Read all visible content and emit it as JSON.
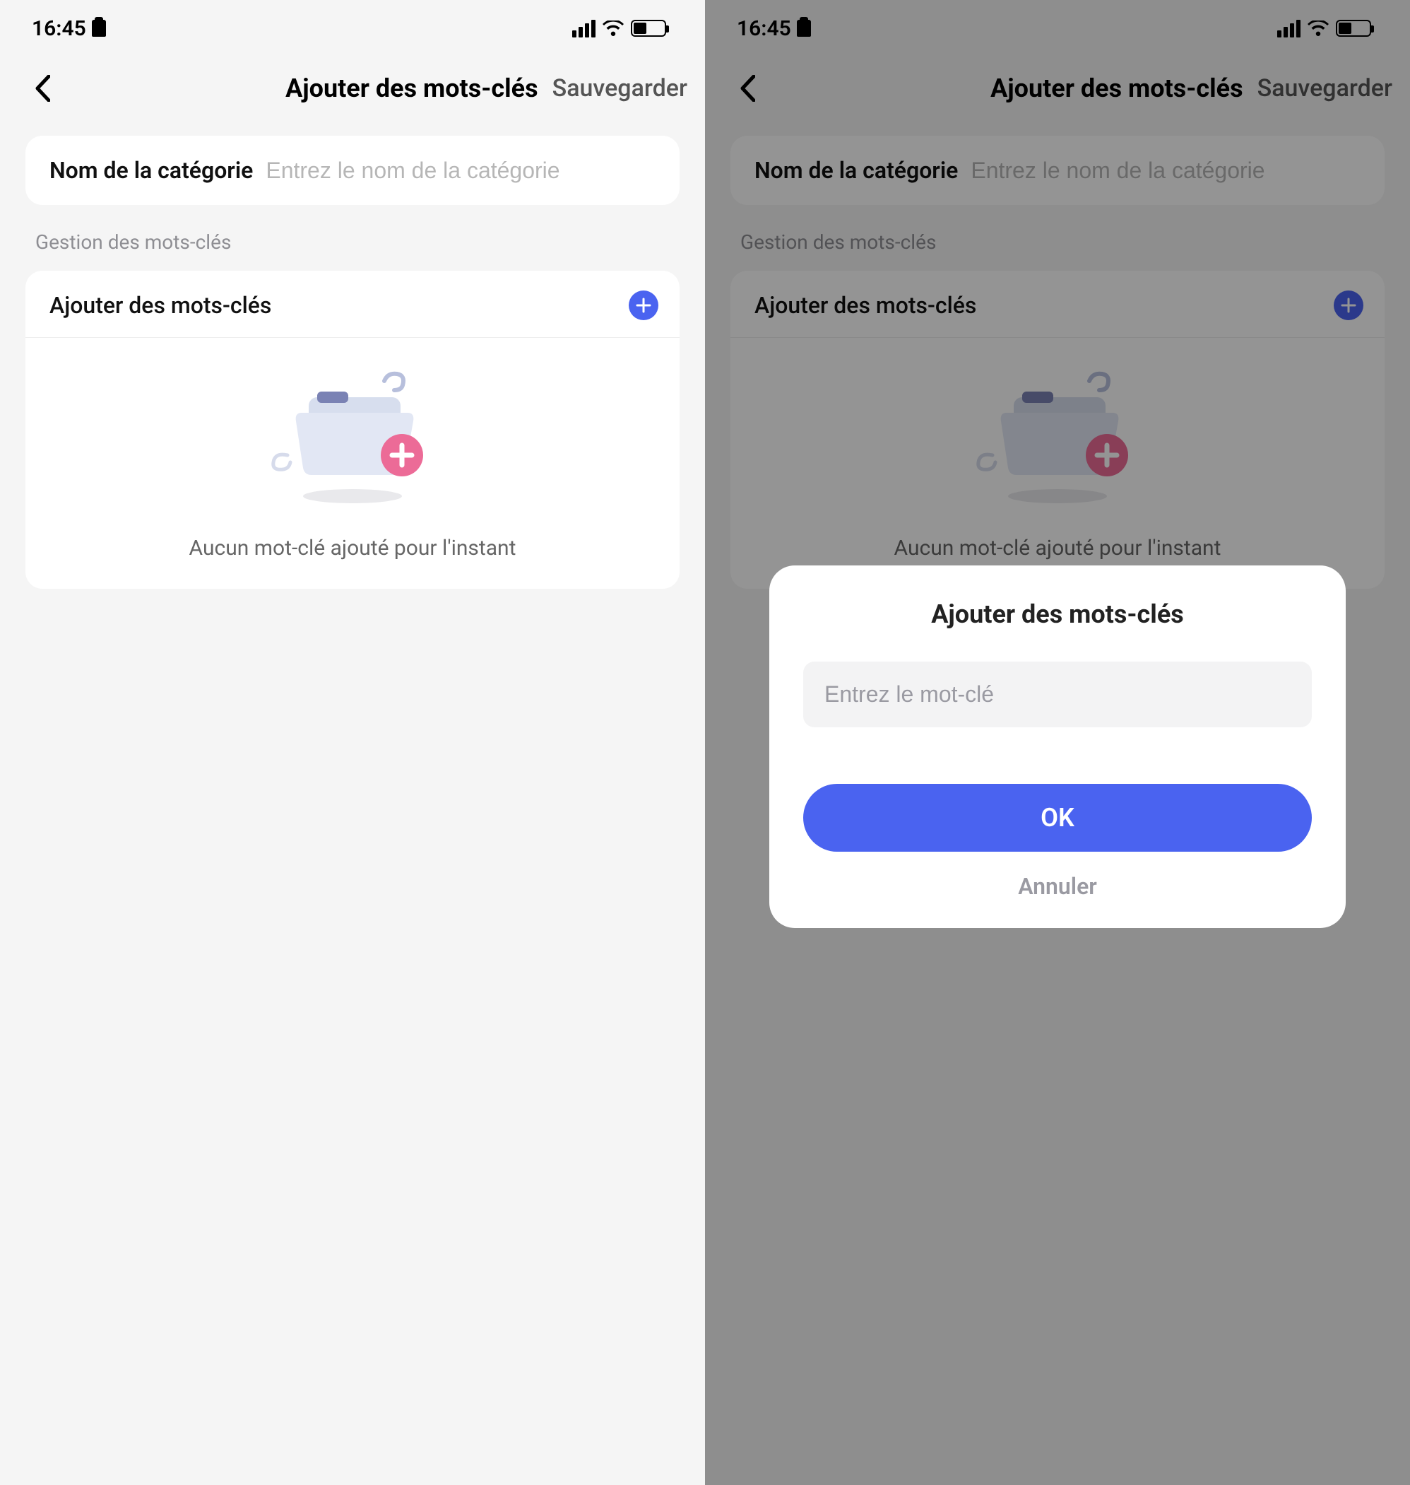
{
  "status": {
    "time": "16:45"
  },
  "nav": {
    "title": "Ajouter des mots-clés",
    "save": "Sauvegarder"
  },
  "category": {
    "label": "Nom de la catégorie",
    "placeholder": "Entrez le nom de la catégorie"
  },
  "section": {
    "label": "Gestion des mots-clés"
  },
  "add": {
    "label": "Ajouter des mots-clés"
  },
  "empty": {
    "text": "Aucun mot-clé ajouté pour l'instant"
  },
  "modal": {
    "title": "Ajouter des mots-clés",
    "placeholder": "Entrez le mot-clé",
    "ok": "OK",
    "cancel": "Annuler"
  }
}
